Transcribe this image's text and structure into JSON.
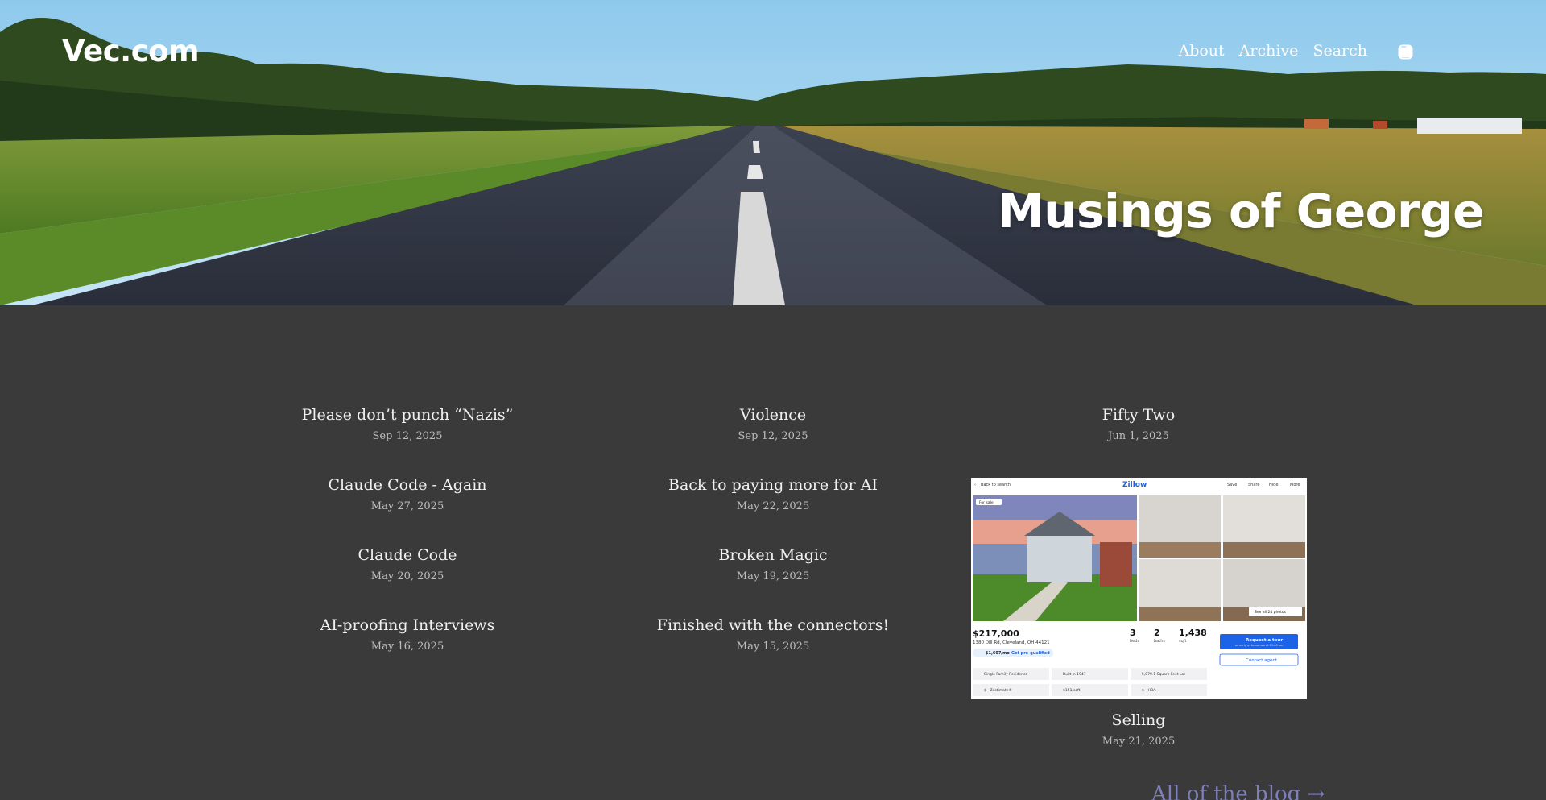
{
  "site": {
    "title": "Vec.com",
    "hero_title": "Musings of George"
  },
  "nav": {
    "items": [
      "About",
      "Archive",
      "Search"
    ]
  },
  "social": [
    "instagram-icon",
    "youtube-icon",
    "twitter-icon"
  ],
  "posts": [
    {
      "title": "Please don’t punch “Nazis”",
      "date": "Sep 12, 2025"
    },
    {
      "title": "Violence",
      "date": "Sep 12, 2025"
    },
    {
      "title": "Fifty Two",
      "date": "Jun 1, 2025"
    },
    {
      "title": "Claude Code - Again",
      "date": "May 27, 2025"
    },
    {
      "title": "Back to paying more for AI",
      "date": "May 22, 2025"
    },
    {
      "title": "Selling",
      "date": "May 21, 2025"
    },
    {
      "title": "Claude Code",
      "date": "May 20, 2025"
    },
    {
      "title": "Broken Magic",
      "date": "May 19, 2025"
    },
    {
      "title": "AI-proofing Interviews",
      "date": "May 16, 2025"
    },
    {
      "title": "Finished with the connectors!",
      "date": "May 15, 2025"
    }
  ],
  "featured_image": {
    "brand": "Zillow",
    "back": "Back to search",
    "actions": [
      "Save",
      "Share",
      "Hide",
      "More"
    ],
    "badge": "For sale",
    "see_all": "See all 24 photos",
    "price": "$217,000",
    "address": "1380 Dill Rd, Cleveland, OH 44121",
    "beds": "3",
    "beds_label": "beds",
    "baths": "2",
    "baths_label": "baths",
    "sqft": "1,438",
    "sqft_label": "sqft",
    "monthly": "$1,607/mo",
    "prequal": "Get pre-qualified",
    "tour_button": "Request a tour",
    "tour_sub": "as early as tomorrow at 11:00 am",
    "contact_button": "Contact agent",
    "facts": [
      "Single Family Residence",
      "Built in 1947",
      "5,079.1 Square Feet Lot",
      "$-- Zestimate®",
      "$151/sqft",
      "$-- HOA"
    ]
  },
  "all_blog_link": "All of the blog →",
  "colors": {
    "background": "#3a3a3a",
    "link_accent": "#7d7fb8",
    "text": "#f0f0f0"
  }
}
